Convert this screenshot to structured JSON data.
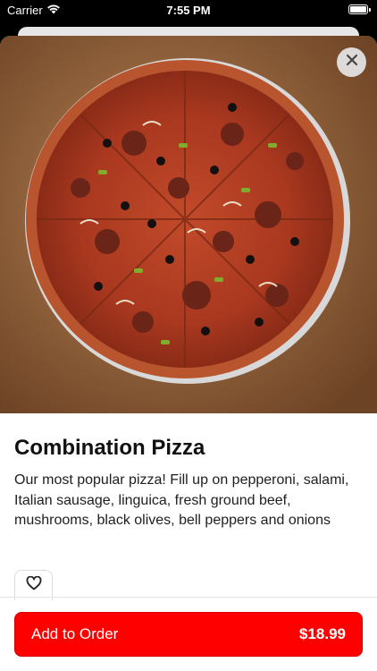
{
  "status_bar": {
    "carrier": "Carrier",
    "time": "7:55 PM"
  },
  "product": {
    "title": "Combination Pizza",
    "description": "Our most popular pizza! Fill up on pepperoni, salami, Italian sausage, linguica, fresh ground beef, mushrooms, black olives, bell peppers and onions"
  },
  "actions": {
    "add_label": "Add to Order",
    "price": "$18.99"
  },
  "icons": {
    "close": "close-icon",
    "favorite": "heart-icon",
    "wifi": "wifi-icon",
    "battery": "battery-icon"
  },
  "colors": {
    "cta_background": "#ff0000",
    "cta_text": "#ffffff"
  }
}
